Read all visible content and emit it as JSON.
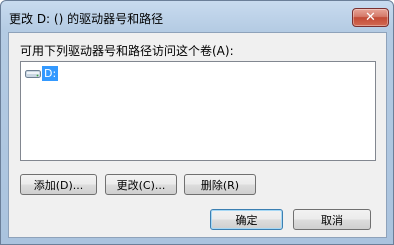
{
  "window": {
    "title": "更改 D: () 的驱动器号和路径",
    "close_glyph": "✕"
  },
  "main": {
    "access_label": "可用下列驱动器号和路径访问这个卷(A):",
    "list_items": [
      {
        "label": "D:",
        "icon": "drive-icon"
      }
    ]
  },
  "buttons": {
    "add": "添加(D)...",
    "change": "更改(C)...",
    "remove": "删除(R)",
    "ok": "确定",
    "cancel": "取消"
  },
  "colors": {
    "selection": "#3399ff",
    "title_gradient": "#b4cbe3",
    "close_button": "#c24a36"
  }
}
